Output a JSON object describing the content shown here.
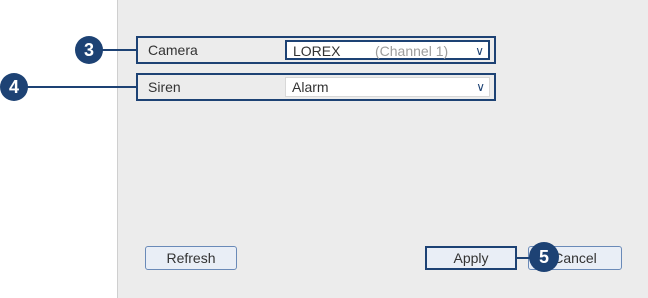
{
  "form": {
    "camera": {
      "label": "Camera",
      "value": "LOREX",
      "hint": "(Channel 1)"
    },
    "siren": {
      "label": "Siren",
      "value": "Alarm"
    }
  },
  "buttons": {
    "refresh": "Refresh",
    "apply": "Apply",
    "cancel": "Cancel"
  },
  "callouts": {
    "camera": "3",
    "siren": "4",
    "apply": "5"
  },
  "icons": {
    "dropdown": "chevron-down-icon",
    "dropdown_glyph": "∨"
  },
  "colors": {
    "callout": "#1d4274",
    "panel": "#ececec"
  }
}
